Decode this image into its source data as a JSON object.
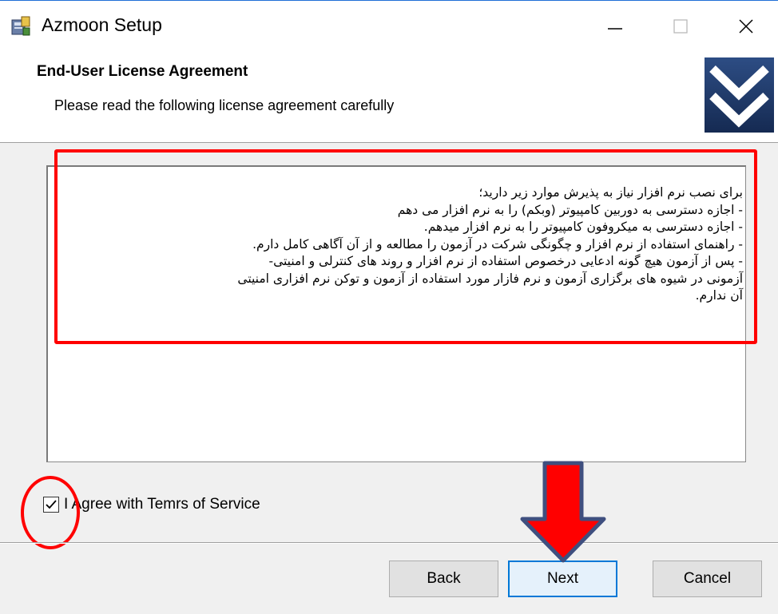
{
  "window": {
    "title": "Azmoon Setup",
    "minimize_label": "—",
    "maximize_label": "□",
    "close_label": "✕"
  },
  "header": {
    "title": "End-User License Agreement",
    "subtitle": "Please read the following license agreement carefully"
  },
  "license": {
    "lines": [
      "برای نصب نرم افزار نیاز به پذیرش موارد زیر دارید؛",
      "- اجازه دسترسی به دوربین کامپیوتر (وبکم) را به نرم افزار می دهم",
      "- اجازه دسترسی به میکروفون کامپیوتر را به نرم افزار میدهم.",
      "- راهنمای استفاده از نرم افزار و چگونگی شرکت در آزمون را مطالعه و از آن آگاهی کامل دارم.",
      "- پس از آزمون هیچ گونه ادعایی درخصوص استفاده از نرم افزار و روند های کنترلی و امنیتی-",
      "آزمونی در شیوه های برگزاری آزمون و نرم فازار مورد استفاده از آزمون و توکن نرم افزاری امنیتی",
      "آن ندارم."
    ]
  },
  "agreement": {
    "checkbox_label": "I Agree with Temrs of Service",
    "checked": true
  },
  "buttons": {
    "back": "Back",
    "next": "Next",
    "cancel": "Cancel"
  },
  "colors": {
    "highlight": "#ff0000",
    "focus_border": "#0078d7",
    "arrow_outline": "#3f4f7f"
  }
}
